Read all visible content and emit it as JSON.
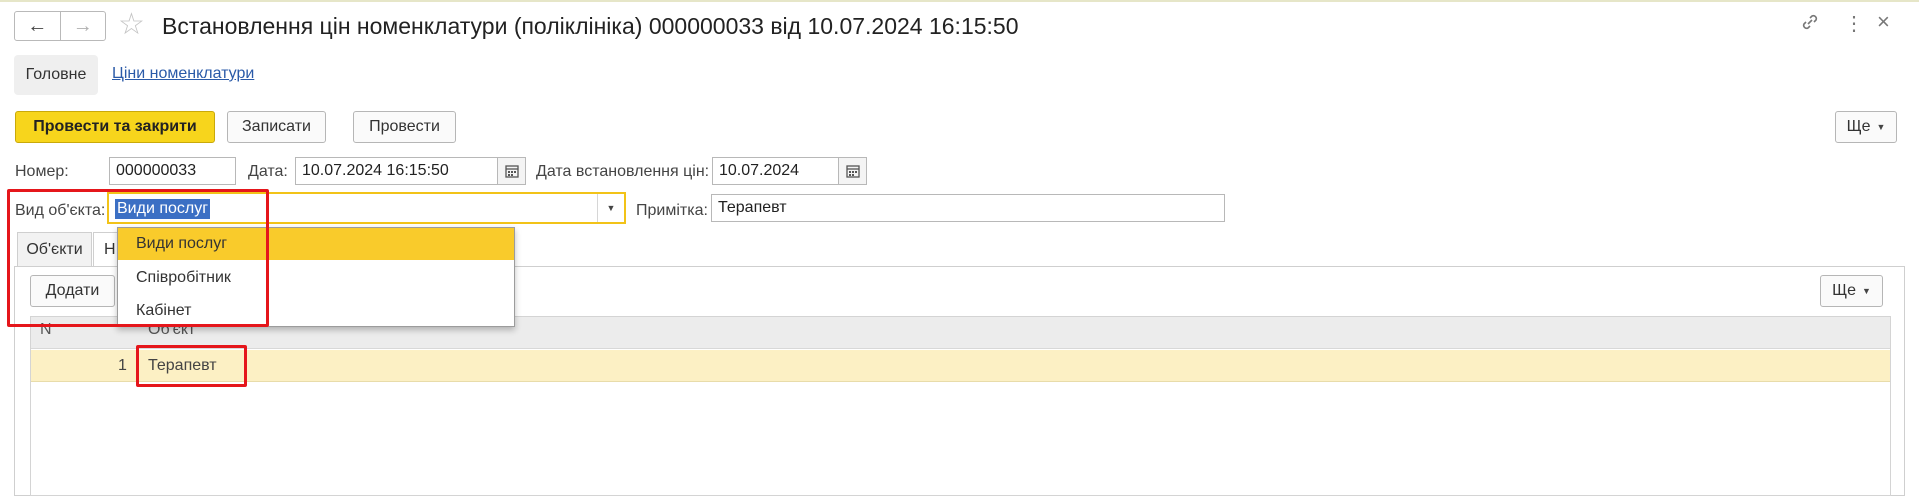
{
  "window": {
    "title": "Встановлення цін номенклатури (поліклініка) 000000033 від 10.07.2024 16:15:50",
    "back_icon": "←",
    "forward_icon": "→",
    "star_icon": "☆",
    "link_icon": "🔗",
    "more_icon": "⋮",
    "close_icon": "×"
  },
  "sections": {
    "main": "Головне",
    "prices_link": "Ціни номенклатури"
  },
  "toolbar": {
    "post_close": "Провести та закрити",
    "save": "Записати",
    "post": "Провести",
    "more": "Ще"
  },
  "fields": {
    "number_label": "Номер:",
    "number_value": "000000033",
    "date_label": "Дата:",
    "date_value": "10.07.2024 16:15:50",
    "price_date_label": "Дата встановлення цін:",
    "price_date_value": "10.07.2024",
    "object_type_label": "Вид об'єкта:",
    "object_type_value": "Види послуг",
    "note_label": "Примітка:",
    "note_value": "Терапевт"
  },
  "dropdown": {
    "options": [
      "Види послуг",
      "Співробітник",
      "Кабінет"
    ],
    "selected_index": 0
  },
  "tabs": {
    "objects": "Об'єкти",
    "second_partial": "Н"
  },
  "table_toolbar": {
    "add": "Додати",
    "more": "Ще"
  },
  "table": {
    "columns": [
      "N",
      "Об'єкт"
    ],
    "rows": [
      {
        "n": "1",
        "object": "Терапевт"
      }
    ]
  },
  "colors": {
    "accent_yellow": "#f7d51c",
    "highlight_red": "#e5161b",
    "row_selected": "#fcf0c4",
    "link_blue": "#2a5aa8"
  }
}
